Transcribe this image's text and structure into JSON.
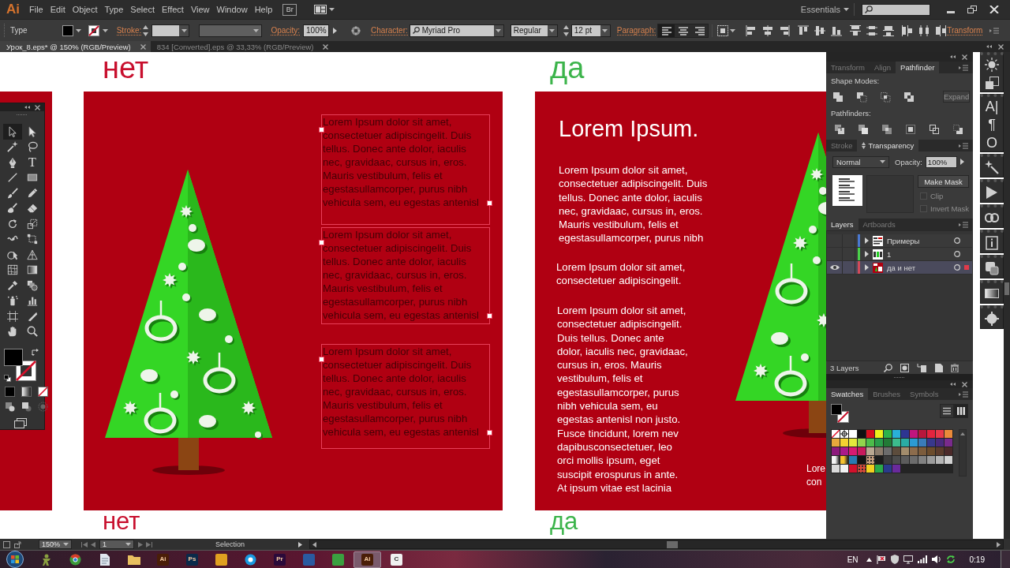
{
  "menu_bar": {
    "logo": "Ai",
    "items": [
      "File",
      "Edit",
      "Object",
      "Type",
      "Select",
      "Effect",
      "View",
      "Window",
      "Help"
    ],
    "bridge_button": "Br",
    "workspace": "Essentials"
  },
  "control_bar": {
    "selection_type": "Type",
    "stroke_label": "Stroke:",
    "opacity_label": "Opacity:",
    "opacity_value": "100%",
    "character_label": "Character:",
    "font_family": "Myriad Pro",
    "font_style": "Regular",
    "font_size": "12 pt",
    "paragraph_label": "Paragraph:",
    "paragraph_align": [
      {
        "kind": "left",
        "selected": true
      },
      {
        "kind": "center",
        "selected": false
      },
      {
        "kind": "right",
        "selected": false
      }
    ],
    "transform_label": "Transform"
  },
  "document_tabs": [
    {
      "title": "Урок_8.eps* @ 150% (RGB/Preview)",
      "selected": true
    },
    {
      "title": "834 [Converted].eps @ 33,33% (RGB/Preview)",
      "selected": false
    }
  ],
  "tools_panel": {
    "tools": [
      {
        "kind": "selection",
        "selected": true
      },
      {
        "kind": "direct-selection",
        "selected": false
      },
      {
        "kind": "magic-wand",
        "selected": false
      },
      {
        "kind": "lasso",
        "selected": false
      },
      {
        "kind": "pen",
        "selected": false
      },
      {
        "kind": "type",
        "glyph": "T",
        "selected": false
      },
      {
        "kind": "line",
        "selected": false
      },
      {
        "kind": "rectangle",
        "selected": false
      },
      {
        "kind": "paintbrush",
        "selected": false
      },
      {
        "kind": "pencil",
        "selected": false
      },
      {
        "kind": "blob-brush",
        "selected": false
      },
      {
        "kind": "eraser",
        "selected": false
      },
      {
        "kind": "rotate",
        "selected": false
      },
      {
        "kind": "scale",
        "selected": false
      },
      {
        "kind": "width",
        "selected": false
      },
      {
        "kind": "free-transform",
        "selected": false
      },
      {
        "kind": "shape-builder",
        "selected": false
      },
      {
        "kind": "perspective-grid",
        "selected": false
      },
      {
        "kind": "mesh",
        "selected": false
      },
      {
        "kind": "gradient",
        "selected": false
      },
      {
        "kind": "eyedropper",
        "selected": false
      },
      {
        "kind": "blend",
        "selected": false
      },
      {
        "kind": "symbol-sprayer",
        "selected": false
      },
      {
        "kind": "column-graph",
        "selected": false
      },
      {
        "kind": "artboard",
        "selected": false
      },
      {
        "kind": "slice",
        "selected": false
      },
      {
        "kind": "hand",
        "selected": false
      },
      {
        "kind": "zoom",
        "selected": false
      }
    ]
  },
  "canvas": {
    "top_labels": [
      {
        "text": "нет",
        "color": "#c8102e"
      },
      {
        "text": "да",
        "color": "#3cb44b"
      }
    ],
    "text_frames": [
      {
        "text": "Lorem Ipsum dolor sit amet,\nconsectetuer adipiscingelit. Duis\ntellus. Donec ante dolor, iaculis\nnec, gravidaac, cursus in, eros.\nMauris vestibulum, felis et\negestasullamcorper, purus nibh\nvehicula sem, eu egestas antenisl",
        "selected": true
      },
      {
        "text": "Lorem Ipsum dolor sit amet,\nconsectetuer adipiscingelit. Duis\ntellus. Donec ante dolor, iaculis\nnec, gravidaac, cursus in, eros.\nMauris vestibulum, felis et\negestasullamcorper, purus nibh\nvehicula sem, eu egestas antenisl",
        "selected": true
      },
      {
        "text": "Lorem Ipsum dolor sit amet,\nconsectetuer adipiscingelit. Duis\ntellus. Donec ante dolor, iaculis\nnec, gravidaac, cursus in, eros.\nMauris vestibulum, felis et\negestasullamcorper, purus nibh\nvehicula sem, eu egestas antenisl",
        "selected": true
      }
    ],
    "right_artboard": {
      "heading": "Lorem Ipsum.",
      "paragraphs": [
        "Lorem Ipsum dolor sit amet,\nconsectetuer adipiscingelit. Duis\ntellus. Donec ante dolor, iaculis\nnec, gravidaac, cursus in, eros.\nMauris vestibulum, felis et\negestasullamcorper, purus nibh",
        "Lorem Ipsum dolor sit amet,\nconsectetuer adipiscingelit.",
        "Lorem Ipsum dolor sit amet,\nconsectetuer adipiscingelit.\nDuis tellus. Donec ante\ndolor, iaculis nec, gravidaac,\ncursus in, eros. Mauris\nvestibulum, felis et\negestasullamcorper, purus\nnibh vehicula sem, eu\negestas antenisl non justo.\nFusce tincidunt, lorem nev\ndapibusconsectetuer, leo\norci mollis ipsum, eget\nsuscipit erospurus in ante.\nAt ipsum vitae est lacinia"
      ],
      "clipped_text": "Lore\ncon"
    },
    "bottom_labels": [
      {
        "text": "нет",
        "color": "#c8102e"
      },
      {
        "text": "да",
        "color": "#3cb44b"
      }
    ]
  },
  "right_panel": {
    "pathfinder_tabs": [
      {
        "label": "Transform",
        "selected": false
      },
      {
        "label": "Align",
        "selected": false
      },
      {
        "label": "Pathfinder",
        "selected": true
      }
    ],
    "shape_modes_label": "Shape Modes:",
    "expand_button": {
      "label": "Expand",
      "disabled": true
    },
    "pathfinders_label": "Pathfinders:",
    "transparency_tabs": [
      {
        "label": "Stroke",
        "selected": false
      },
      {
        "label": "Transparency",
        "selected": true
      }
    ],
    "blend_mode": "Normal",
    "opacity_label": "Opacity:",
    "opacity_value": "100%",
    "make_mask_button": "Make Mask",
    "mask_options": [
      {
        "label": "Clip",
        "checked": false,
        "disabled": true
      },
      {
        "label": "Invert Mask",
        "checked": false,
        "disabled": true
      }
    ],
    "layers_tabs": [
      {
        "label": "Layers",
        "selected": true
      },
      {
        "label": "Artboards",
        "selected": false
      }
    ],
    "layers": [
      {
        "name": "Примеры",
        "color": "#4a78d0",
        "visible": false,
        "selected": false
      },
      {
        "name": "1",
        "color": "#4ad04a",
        "visible": false,
        "selected": false
      },
      {
        "name": "да и нет",
        "color": "#d04a5a",
        "visible": true,
        "selected": true
      }
    ],
    "layers_count": "3 Layers",
    "swatches_tabs": [
      {
        "label": "Swatches",
        "selected": true
      },
      {
        "label": "Brushes",
        "selected": false
      },
      {
        "label": "Symbols",
        "selected": false
      }
    ],
    "swatch_views": [
      {
        "kind": "list",
        "selected": false
      },
      {
        "kind": "grid",
        "selected": true
      }
    ],
    "swatches": [
      {
        "kind": "none"
      },
      {
        "kind": "registration"
      },
      {
        "kind": "color",
        "color": "#ffffff"
      },
      {
        "kind": "color",
        "color": "#111111"
      },
      {
        "kind": "color",
        "color": "#d7101e"
      },
      {
        "kind": "color",
        "color": "#eef01c"
      },
      {
        "kind": "color",
        "color": "#2cb34a"
      },
      {
        "kind": "color",
        "color": "#29b0d8"
      },
      {
        "kind": "color",
        "color": "#2e3592"
      },
      {
        "kind": "color",
        "color": "#c0157e"
      },
      {
        "kind": "color",
        "color": "#b8173c"
      },
      {
        "kind": "color",
        "color": "#e3243e"
      },
      {
        "kind": "color",
        "color": "#e83a4a"
      },
      {
        "kind": "color",
        "color": "#ea8a3a"
      },
      {
        "kind": "color",
        "color": "#e6a83c"
      },
      {
        "kind": "color",
        "color": "#f4d230"
      },
      {
        "kind": "color",
        "color": "#e4e83c"
      },
      {
        "kind": "color",
        "color": "#92d44c"
      },
      {
        "kind": "color",
        "color": "#4cbc4a"
      },
      {
        "kind": "color",
        "color": "#2a9c4a"
      },
      {
        "kind": "color",
        "color": "#227a36"
      },
      {
        "kind": "color",
        "color": "#3cbc8c"
      },
      {
        "kind": "color",
        "color": "#2aaca4"
      },
      {
        "kind": "color",
        "color": "#2c9ad2"
      },
      {
        "kind": "color",
        "color": "#3a7cba"
      },
      {
        "kind": "color",
        "color": "#38388c"
      },
      {
        "kind": "color",
        "color": "#4a2a7c"
      },
      {
        "kind": "color",
        "color": "#7a2a8c"
      },
      {
        "kind": "color",
        "color": "#8c1a7c"
      },
      {
        "kind": "color",
        "color": "#aa1a8a"
      },
      {
        "kind": "color",
        "color": "#d81a72"
      },
      {
        "kind": "color",
        "color": "#c81a5c"
      },
      {
        "kind": "color",
        "color": "#baa892"
      },
      {
        "kind": "color",
        "color": "#8c7c6c"
      },
      {
        "kind": "color",
        "color": "#6c6c6c"
      },
      {
        "kind": "color",
        "color": "#5c4c3c"
      },
      {
        "kind": "color",
        "color": "#a28c6c"
      },
      {
        "kind": "color",
        "color": "#8c6c4c"
      },
      {
        "kind": "color",
        "color": "#7c5c3c"
      },
      {
        "kind": "color",
        "color": "#6c4c2c"
      },
      {
        "kind": "color",
        "color": "#5c3c2c"
      },
      {
        "kind": "color",
        "color": "#4c2a2a"
      },
      {
        "kind": "gradient",
        "color": "#f4f4f4"
      },
      {
        "kind": "gradient",
        "color": "#f4c030"
      },
      {
        "kind": "color",
        "color": "#2a7ab2"
      },
      {
        "kind": "color",
        "color": "#141414"
      },
      {
        "kind": "pattern",
        "color": "#c8a080"
      },
      {
        "kind": "color",
        "color": "#1c1c1c"
      },
      {
        "kind": "color",
        "color": "#3c3c3c"
      },
      {
        "kind": "color",
        "color": "#4c4c4c"
      },
      {
        "kind": "color",
        "color": "#5c5c5c"
      },
      {
        "kind": "color",
        "color": "#6c6c6c"
      },
      {
        "kind": "color",
        "color": "#828282"
      },
      {
        "kind": "color",
        "color": "#9c9c9c"
      },
      {
        "kind": "color",
        "color": "#b6b6b6"
      },
      {
        "kind": "color",
        "color": "#d2d2d2"
      },
      {
        "kind": "color",
        "color": "#dadada"
      },
      {
        "kind": "color",
        "color": "#f2f2f2"
      },
      {
        "kind": "color",
        "color": "#d2102c"
      },
      {
        "kind": "pattern",
        "color": "#d84a3a"
      },
      {
        "kind": "color",
        "color": "#f2d020"
      },
      {
        "kind": "color",
        "color": "#2aaa4a"
      },
      {
        "kind": "color",
        "color": "#2a3a8c"
      },
      {
        "kind": "color",
        "color": "#6a2a9c"
      }
    ]
  },
  "dock": [
    {
      "kind": "sun"
    },
    {
      "kind": "stacked-squares"
    },
    {
      "kind": "glyph",
      "glyph": "A|"
    },
    {
      "kind": "glyph",
      "glyph": "¶"
    },
    {
      "kind": "glyph",
      "glyph": "O"
    },
    {
      "kind": "wand"
    },
    {
      "kind": "play"
    },
    {
      "kind": "link"
    },
    {
      "kind": "info"
    },
    {
      "kind": "styles"
    },
    {
      "kind": "gradient"
    },
    {
      "kind": "circle"
    }
  ],
  "status_bar": {
    "zoom": "150%",
    "artboard": "1",
    "current_tool": "Selection"
  },
  "taskbar": {
    "apps": [
      {
        "kind": "figure",
        "color": "#8aa040",
        "selected": false
      },
      {
        "kind": "ring",
        "color": "#3a9a3a",
        "selected": false
      },
      {
        "kind": "document",
        "color": "#dfe6ee",
        "selected": false
      },
      {
        "kind": "folder",
        "color": "#e8c060",
        "selected": false
      },
      {
        "kind": "tile",
        "color": "#4a1e08",
        "label": "Ai",
        "selected": false
      },
      {
        "kind": "tile",
        "color": "#0a2a4a",
        "label": "Ps",
        "selected": false
      },
      {
        "kind": "tile",
        "color": "#e0a020",
        "selected": false
      },
      {
        "kind": "bubble",
        "color": "#1a9ae0",
        "selected": false
      },
      {
        "kind": "tile",
        "color": "#2a0a3a",
        "label": "Pr",
        "selected": false
      },
      {
        "kind": "tile",
        "color": "#2a5aa0",
        "selected": false
      },
      {
        "kind": "tile",
        "color": "#3aa040",
        "selected": false
      },
      {
        "kind": "tile",
        "color": "#4a1e08",
        "label": "Ai",
        "selected": true
      },
      {
        "kind": "tile",
        "color": "#f0f0f0",
        "label": "C",
        "selected": false
      }
    ],
    "language": "EN",
    "time": "0:19"
  }
}
